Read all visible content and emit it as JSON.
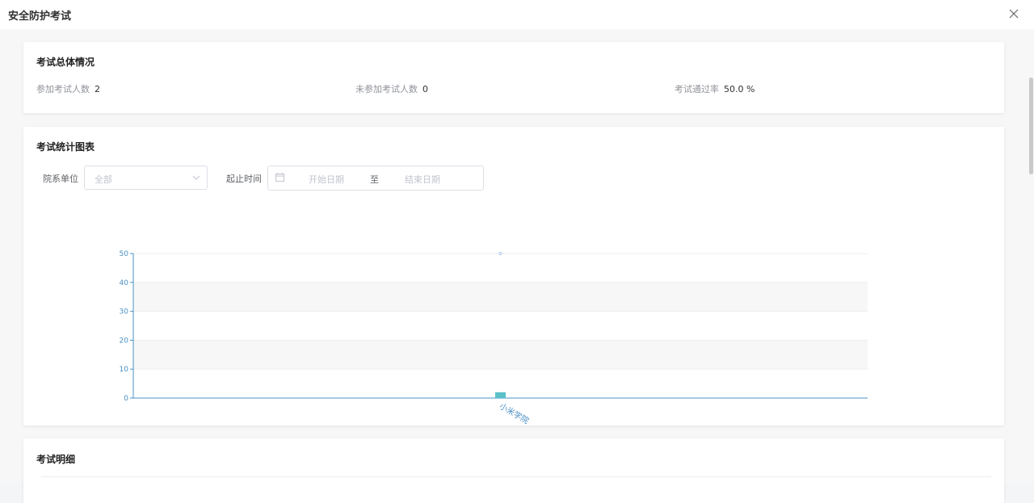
{
  "modal": {
    "title": "安全防护考试"
  },
  "overview": {
    "title": "考试总体情况",
    "stats": [
      {
        "label": "参加考试人数",
        "value": "2"
      },
      {
        "label": "未参加考试人数",
        "value": "0"
      },
      {
        "label": "考试通过率",
        "value": "50.0 %"
      }
    ]
  },
  "chart_card": {
    "title": "考试统计图表",
    "filters": {
      "dept_label": "院系单位",
      "dept_placeholder": "全部",
      "time_label": "起止时间",
      "start_placeholder": "开始日期",
      "range_separator": "至",
      "end_placeholder": "结束日期"
    }
  },
  "detail_card": {
    "title": "考试明细"
  },
  "colors": {
    "bar": "#5bc0c8",
    "axis": "#4a90c4",
    "line_point": "#a8c8e8"
  },
  "chart_data": {
    "type": "bar",
    "categories": [
      "小米学院"
    ],
    "series": [
      {
        "type": "bar",
        "values": [
          2
        ]
      },
      {
        "type": "line",
        "values": [
          50
        ]
      }
    ],
    "ylim": [
      0,
      50
    ],
    "yticks": [
      0,
      10,
      20,
      30,
      40,
      50
    ],
    "grid": true,
    "striped_bands": true
  },
  "icons": {
    "close": "close-icon",
    "calendar": "calendar-icon",
    "dropdown": "chevron-down-icon"
  }
}
